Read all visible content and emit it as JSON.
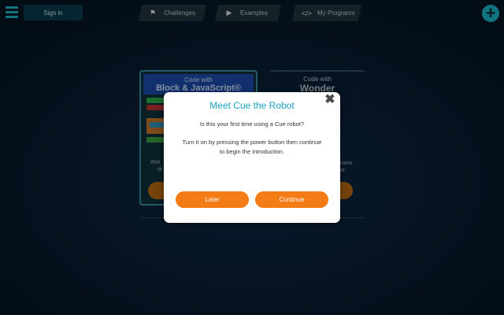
{
  "topbar": {
    "sign_in": "Sign in",
    "nav": [
      {
        "label": "Challenges",
        "icon": "flag-icon"
      },
      {
        "label": "Examples",
        "icon": "play-icon"
      },
      {
        "label": "My Programs",
        "icon": "code-icon"
      }
    ],
    "add_icon": "plus-icon"
  },
  "cards": {
    "left": {
      "small": "Code with",
      "big": "Block & JavaScript®",
      "desc_fragment_1": "Writ",
      "desc_fragment_2": "dr"
    },
    "right": {
      "small": "Code with",
      "big": "Wonder",
      "desc_fragment_1": "rams",
      "desc_fragment_2": "or."
    }
  },
  "modal": {
    "title": "Meet Cue the Robot",
    "question": "Is this your first time using a Cue robot?",
    "body": "Turn it on by pressing the power button then continue to begin the introduction.",
    "later_label": "Later",
    "continue_label": "Continue"
  },
  "colors": {
    "accent": "#1aa0bb",
    "button": "#f47c16",
    "background": "#071626"
  }
}
